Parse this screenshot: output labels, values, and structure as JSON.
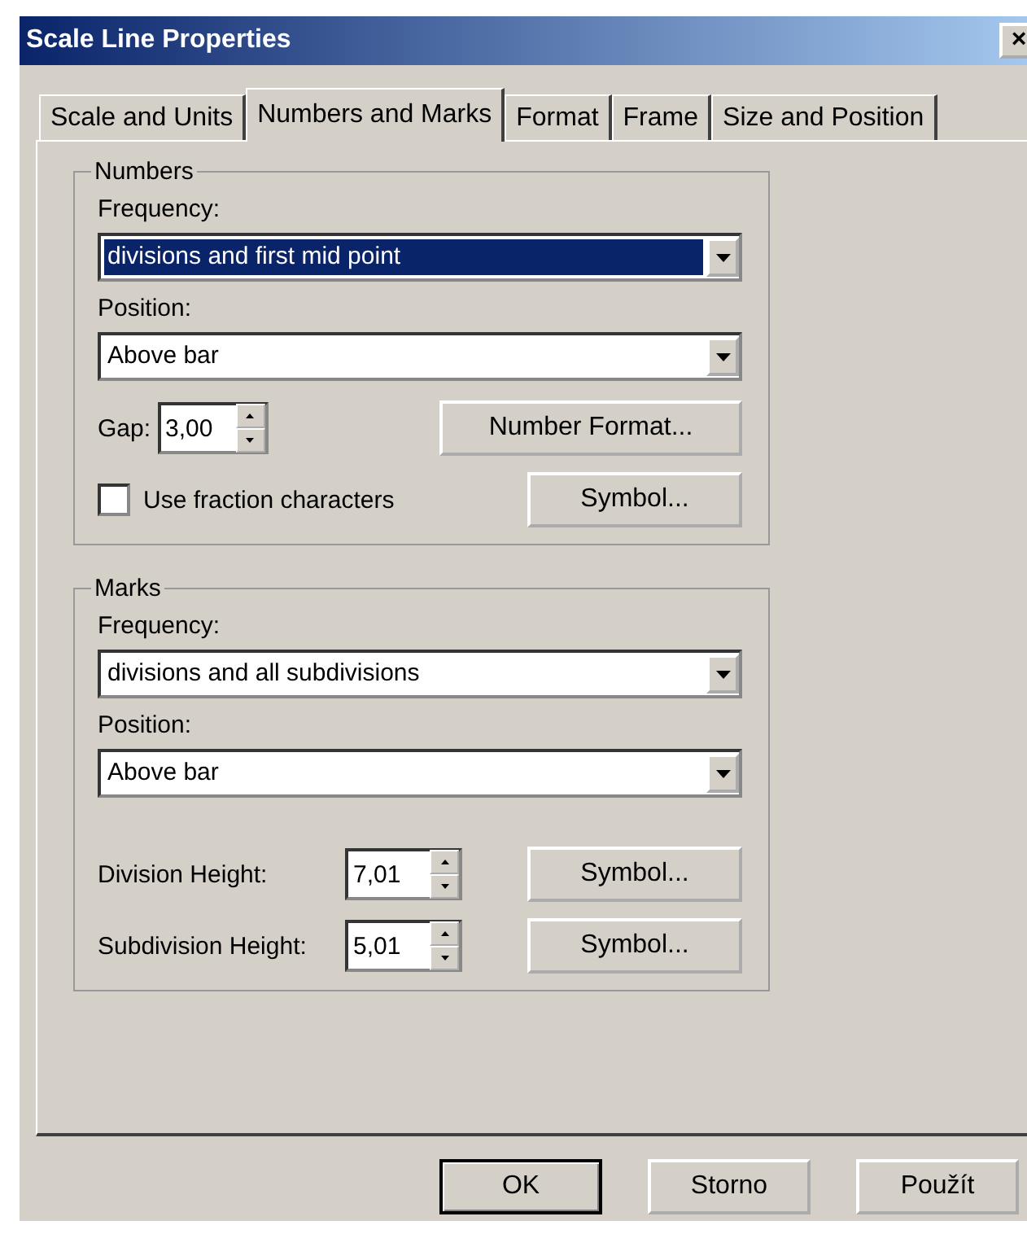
{
  "window": {
    "title": "Scale Line Properties",
    "close": "×"
  },
  "tabs": [
    {
      "label": "Scale and Units",
      "selected": false
    },
    {
      "label": "Numbers and Marks",
      "selected": true
    },
    {
      "label": "Format",
      "selected": false
    },
    {
      "label": "Frame",
      "selected": false
    },
    {
      "label": "Size and Position",
      "selected": false
    }
  ],
  "numbers": {
    "title": "Numbers",
    "frequency_label": "Frequency:",
    "frequency": {
      "value": "divisions and first mid point",
      "focused": true
    },
    "position_label": "Position:",
    "position": {
      "value": "Above bar",
      "focused": false
    },
    "gap_label": "Gap:",
    "gap": "3,00",
    "number_format_button": "Number Format...",
    "fraction": {
      "label": "Use fraction characters",
      "checked": false
    },
    "symbol_button": "Symbol..."
  },
  "marks": {
    "title": "Marks",
    "frequency_label": "Frequency:",
    "frequency": {
      "value": "divisions and all subdivisions",
      "focused": false
    },
    "position_label": "Position:",
    "position": {
      "value": "Above bar",
      "focused": false
    },
    "heights": [
      {
        "label": "Division Height:",
        "value": "7,01",
        "button": "Symbol..."
      },
      {
        "label": "Subdivision Height:",
        "value": "5,01",
        "button": "Symbol..."
      }
    ]
  },
  "buttons": [
    {
      "label": "OK",
      "default": true
    },
    {
      "label": "Storno",
      "default": false
    },
    {
      "label": "Použít",
      "default": false
    }
  ]
}
